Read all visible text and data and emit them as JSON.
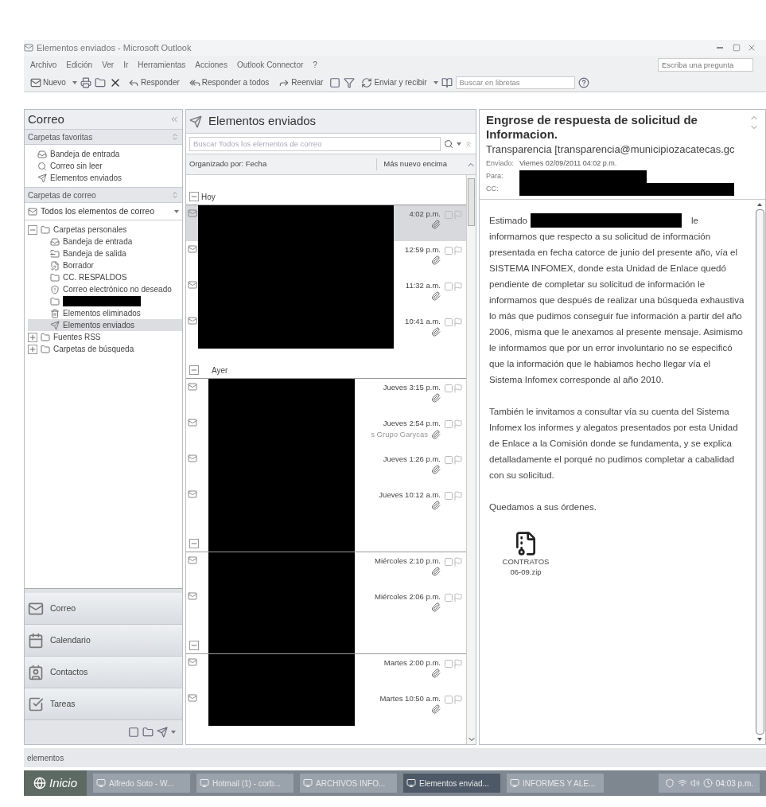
{
  "window": {
    "title": "Elementos enviados - Microsoft Outlook",
    "help_placeholder": "Escriba una pregunta"
  },
  "menu": [
    "Archivo",
    "Edición",
    "Ver",
    "Ir",
    "Herramientas",
    "Acciones",
    "Outlook Connector",
    "?"
  ],
  "toolbar": {
    "new": "Nuevo",
    "reply": "Responder",
    "reply_all": "Responder a todos",
    "forward": "Reenviar",
    "send_receive": "Enviar y recibir",
    "address_search_placeholder": "Buscar en libretas"
  },
  "nav": {
    "title": "Correo",
    "favorites": {
      "label": "Carpetas favoritas",
      "items": [
        {
          "label": "Bandeja de entrada",
          "kind": "inbox"
        },
        {
          "label": "Correo sin leer",
          "kind": "search"
        },
        {
          "label": "Elementos enviados",
          "kind": "sent"
        }
      ]
    },
    "mail_folders": "Carpetas de correo",
    "all_items": "Todos los elementos de correo",
    "tree": [
      {
        "label": "Carpetas personales",
        "expanded": true,
        "children": [
          {
            "label": "Bandeja de entrada",
            "kind": "inbox",
            "selected": false
          },
          {
            "label": "Bandeja de salida",
            "kind": "outbox",
            "selected": false
          },
          {
            "label": "Borrador",
            "kind": "drafts",
            "selected": false
          },
          {
            "label": "CC. RESPALDOS",
            "kind": "folder",
            "selected": false
          },
          {
            "label": "Correo electrónico no deseado",
            "kind": "junk",
            "selected": false
          },
          {
            "kind": "redacted",
            "selected": false
          },
          {
            "label": "Elementos eliminados",
            "kind": "trash",
            "selected": false
          },
          {
            "label": "Elementos enviados",
            "kind": "sent",
            "selected": true
          }
        ]
      },
      {
        "label": "Fuentes RSS",
        "expanded": false
      },
      {
        "label": "Carpetas de búsqueda",
        "expanded": false
      }
    ],
    "buttons": [
      {
        "label": "Correo",
        "kind": "mail"
      },
      {
        "label": "Calendario",
        "kind": "calendar"
      },
      {
        "label": "Contactos",
        "kind": "contacts"
      },
      {
        "label": "Tareas",
        "kind": "tasks"
      }
    ]
  },
  "list": {
    "title": "Elementos enviados",
    "search_placeholder": "Buscar Todos los elementos de correo",
    "arranged_by": "Organizado por: Fecha",
    "sort": "Más nuevo encima",
    "groups": [
      {
        "label": "Hoy",
        "expanded": true,
        "messages": [
          {
            "time": "4:02 p.m.",
            "selected": true,
            "attachment": true
          },
          {
            "time": "12:59 p.m.",
            "selected": false,
            "attachment": true
          },
          {
            "time": "11:32 a.m.",
            "selected": false,
            "attachment": true
          },
          {
            "time": "10:41 a.m.",
            "selected": false,
            "attachment": true
          }
        ]
      },
      {
        "label": "Ayer",
        "expanded": true,
        "messages": [
          {
            "time": "Jueves 3:15 p.m.",
            "selected": false,
            "attachment": true
          },
          {
            "time": "Jueves 2:54 p.m.",
            "selected": false,
            "attachment": true,
            "note": "s Grupo Garycas"
          },
          {
            "time": "Jueves 1:26 p.m.",
            "selected": false,
            "attachment": true
          },
          {
            "time": "Jueves 10:12 a.m.",
            "selected": false,
            "attachment": true
          }
        ]
      },
      {
        "expanded": true,
        "messages": [
          {
            "time": "Miércoles 2:10 p.m.",
            "selected": false,
            "attachment": true
          },
          {
            "time": "Miércoles 2:06 p.m.",
            "selected": false,
            "attachment": true
          }
        ]
      },
      {
        "expanded": true,
        "messages": [
          {
            "time": "Martes 2:00 p.m.",
            "selected": false,
            "attachment": true
          },
          {
            "time": "Martes 10:50 a.m.",
            "selected": false,
            "attachment": true
          }
        ]
      }
    ]
  },
  "reading": {
    "subject": "Engrose de respuesta de solicitud de Informacion.",
    "from": "Transparencia [transparencia@municipiozacatecas.gc",
    "fields": [
      {
        "label": "Enviado:",
        "value": "Viernes 02/09/2011 04:02 p.m."
      },
      {
        "label": "Para:",
        "redacted": true
      },
      {
        "label": "CC:",
        "redacted": true
      }
    ],
    "greeting": {
      "before": "Estimado",
      "after": "le"
    },
    "paragraphs": [
      "informamos que respecto a su solicitud de información presentada en fecha catorce de junio del presente año, vía el SISTEMA INFOMEX, donde esta Unidad de Enlace quedó pendiente de completar su solicitud de información le informamos que después de realizar una búsqueda exhaustiva lo más que pudimos conseguir fue información a partir del año 2006, misma que le anexamos al presente mensaje. Asimismo le informamos que por un error involuntario no se especificó que la información que le habiamos hecho llegar vía el Sistema Infomex corresponde al año 2010.",
      "También le invitamos a consultar vía su cuenta del Sistema Infomex los informes y alegatos presentados por esta Unidad de Enlace a la Comisión donde se fundamenta, y se explica detalladamente el porqué no pudimos completar a cabalidad con su solicitud.",
      "Quedamos a sus órdenes."
    ],
    "attachment": {
      "name": "CONTRATOS 06-09.zip"
    }
  },
  "status_bar": "elementos",
  "taskbar": {
    "start": "Inicio",
    "tasks": [
      "Alfredo Soto - W...",
      "Hotmail (1) - corb...",
      "ARCHIVOS INFO...",
      "Elementos enviad...",
      "INFORMES Y ALE..."
    ],
    "clock": "04:03 p.m."
  }
}
